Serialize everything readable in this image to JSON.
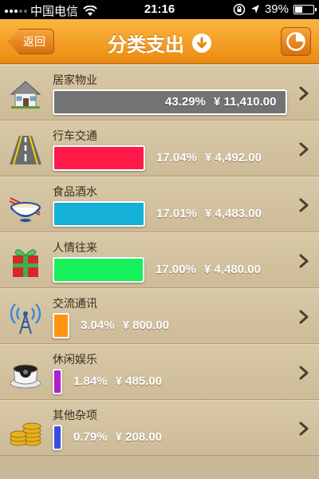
{
  "status_bar": {
    "carrier": "中国电信",
    "time": "21:16",
    "battery": "39%",
    "battery_level": 0.39
  },
  "nav": {
    "back_label": "返回",
    "title": "分类支出",
    "accent": "#f0951f"
  },
  "categories": [
    {
      "name": "居家物业",
      "percent": "43.29%",
      "amount": "¥ 11,410.00",
      "share": 0.4329,
      "color": "#737373",
      "icon": "house-icon"
    },
    {
      "name": "行车交通",
      "percent": "17.04%",
      "amount": "¥ 4,492.00",
      "share": 0.1704,
      "color": "#ff1a4a",
      "icon": "road-icon"
    },
    {
      "name": "食品酒水",
      "percent": "17.01%",
      "amount": "¥ 4,483.00",
      "share": 0.1701,
      "color": "#14b0d8",
      "icon": "noodle-bowl-icon"
    },
    {
      "name": "人情往来",
      "percent": "17.00%",
      "amount": "¥ 4,480.00",
      "share": 0.17,
      "color": "#16f05a",
      "icon": "gift-icon"
    },
    {
      "name": "交流通讯",
      "percent": "3.04%",
      "amount": "¥ 800.00",
      "share": 0.0304,
      "color": "#ff9410",
      "icon": "antenna-icon"
    },
    {
      "name": "休闲娱乐",
      "percent": "1.84%",
      "amount": "¥ 485.00",
      "share": 0.0184,
      "color": "#b020c8",
      "icon": "coffee-cup-icon"
    },
    {
      "name": "其他杂项",
      "percent": "0.79%",
      "amount": "¥ 208.00",
      "share": 0.0079,
      "color": "#3a4fe0",
      "icon": "coins-icon"
    }
  ]
}
